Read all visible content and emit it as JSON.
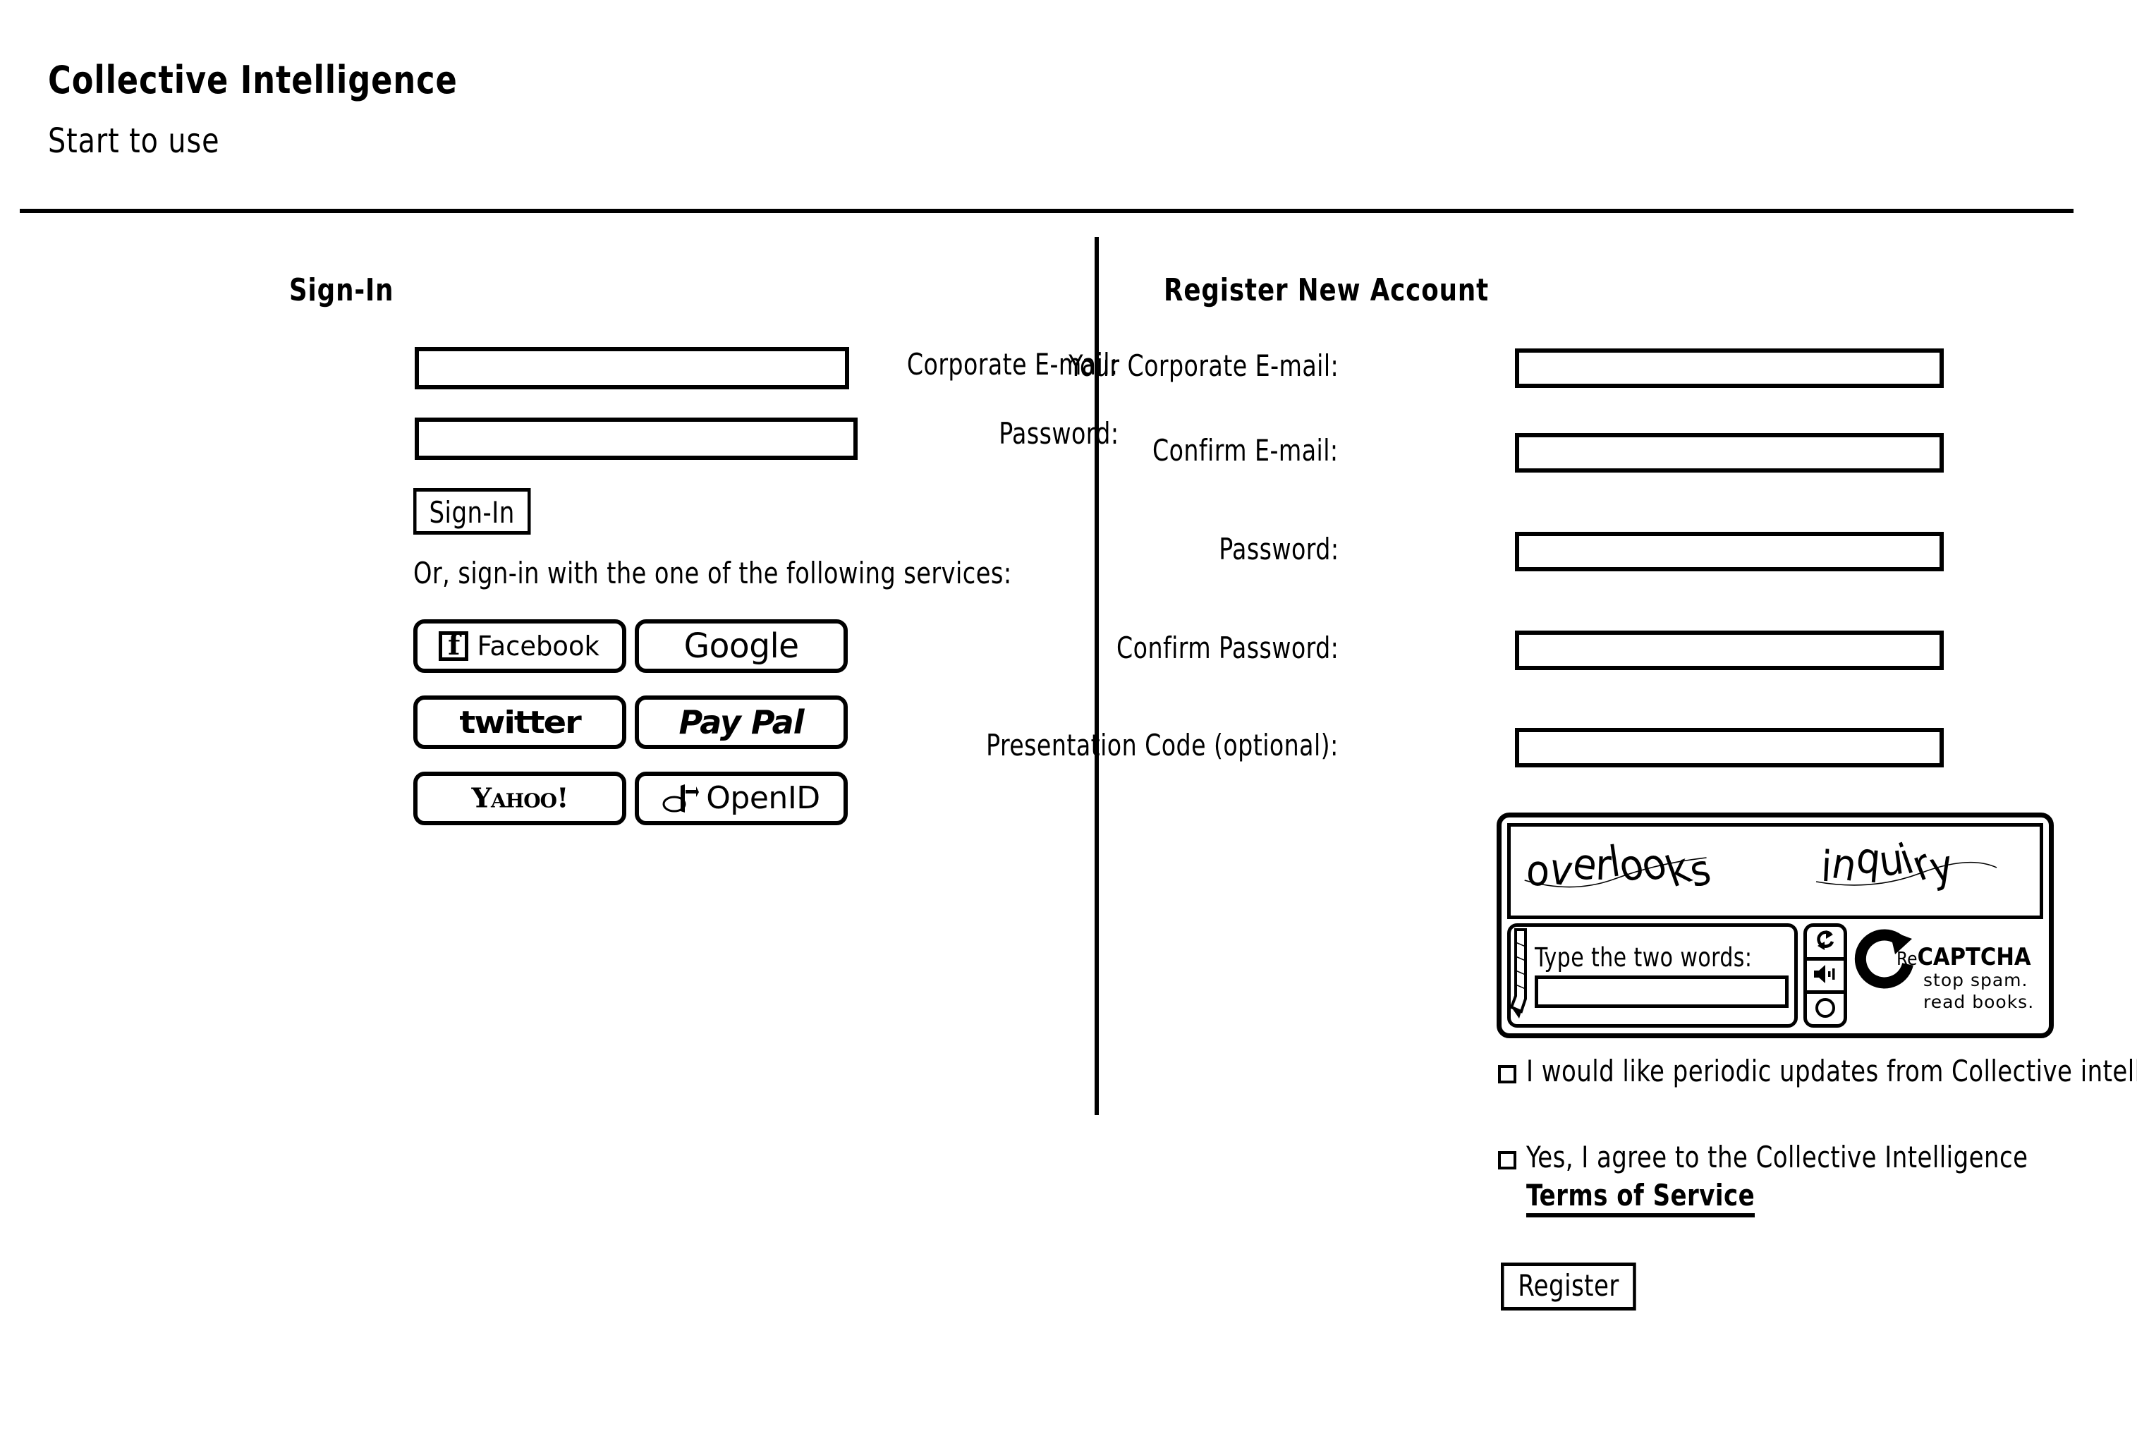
{
  "header": {
    "app_title": "Collective Intelligence",
    "subtitle": "Start to use"
  },
  "signin": {
    "heading": "Sign-In",
    "email_label": "Corporate E-mail:",
    "email_value": "",
    "password_label": "Password:",
    "password_value": "",
    "submit_label": "Sign-In",
    "services_note": "Or, sign-in with the one of the following services:",
    "providers": [
      {
        "id": "facebook",
        "label": "Facebook",
        "icon": "facebook-icon"
      },
      {
        "id": "google",
        "label": "Google",
        "icon": "google-wordmark"
      },
      {
        "id": "twitter",
        "label": "twitter",
        "icon": "twitter-wordmark"
      },
      {
        "id": "paypal",
        "label": "Pay Pal",
        "icon": "paypal-wordmark"
      },
      {
        "id": "yahoo",
        "label": "Yahoo!",
        "icon": "yahoo-wordmark"
      },
      {
        "id": "openid",
        "label": "OpenID",
        "icon": "openid-icon"
      }
    ]
  },
  "register": {
    "heading": "Register New Account",
    "fields": [
      {
        "id": "email",
        "label": "Your Corporate E-mail:",
        "value": ""
      },
      {
        "id": "confirm_email",
        "label": "Confirm E-mail:",
        "value": ""
      },
      {
        "id": "password",
        "label": "Password:",
        "value": ""
      },
      {
        "id": "confirm_password",
        "label": "Confirm Password:",
        "value": ""
      },
      {
        "id": "presentation",
        "label": "Presentation Code (optional):",
        "value": ""
      }
    ],
    "captcha": {
      "word_1": "overlooks",
      "word_2": "inquiry",
      "prompt": "Type the two words:",
      "input_value": "",
      "controls": [
        {
          "id": "refresh",
          "icon": "refresh-icon"
        },
        {
          "id": "audio",
          "icon": "speaker-icon"
        },
        {
          "id": "help",
          "icon": "help-circle-icon"
        }
      ],
      "brand_prefix": "Re",
      "brand_name": "CAPTCHA",
      "tagline_line_1": "stop spam.",
      "tagline_line_2": "read books."
    },
    "checkbox_updates": {
      "checked": false,
      "text": "I would like periodic updates from Collective intelligence"
    },
    "checkbox_terms": {
      "checked": false,
      "text": "Yes, I agree to the Collective Intelligence",
      "link_label": "Terms of Service"
    },
    "submit_label": "Register"
  },
  "colors": {
    "ink": "#000000",
    "paper": "#ffffff"
  }
}
